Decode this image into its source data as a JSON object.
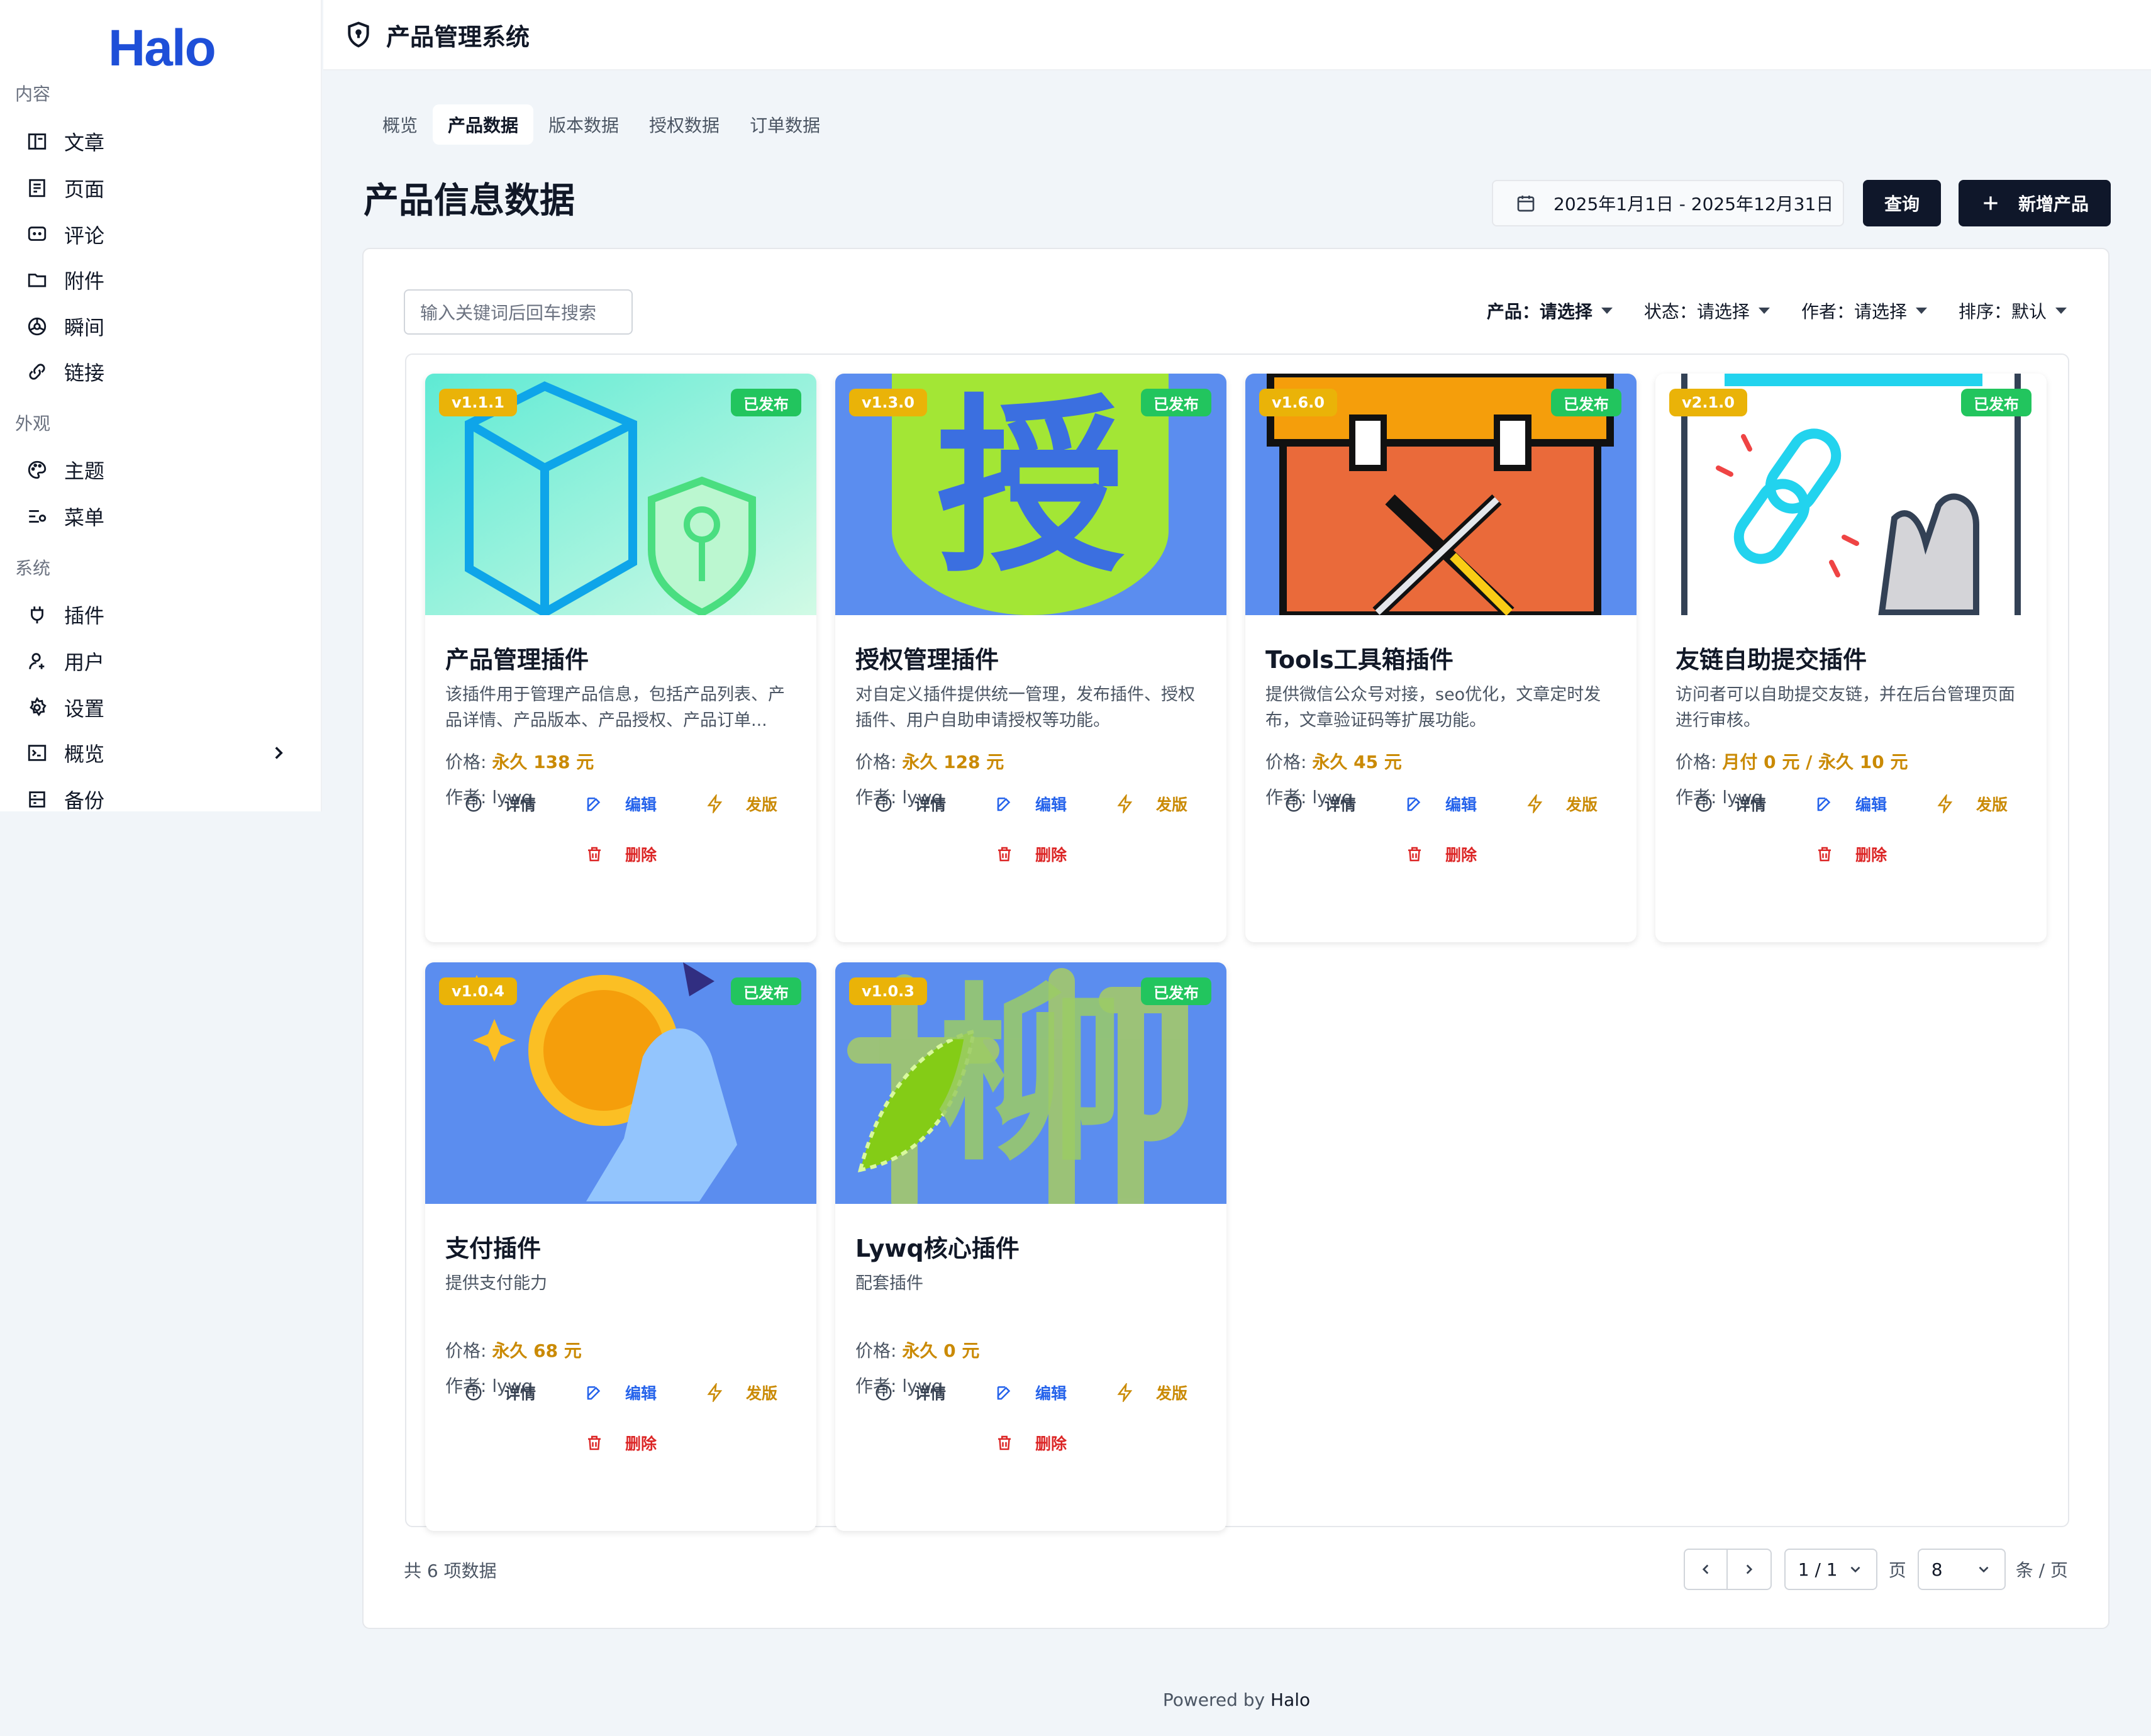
{
  "logo": "Halo",
  "sidebar": {
    "cut_label": "内容",
    "items_content": [
      {
        "label": "文章",
        "icon": "article-icon"
      },
      {
        "label": "页面",
        "icon": "page-icon"
      },
      {
        "label": "评论",
        "icon": "comment-icon"
      },
      {
        "label": "附件",
        "icon": "folder-icon"
      },
      {
        "label": "瞬间",
        "icon": "moment-icon"
      },
      {
        "label": "链接",
        "icon": "link-icon"
      }
    ],
    "group_appearance": "外观",
    "items_appearance": [
      {
        "label": "主题",
        "icon": "palette-icon"
      },
      {
        "label": "菜单",
        "icon": "menu-icon"
      }
    ],
    "group_system": "系统",
    "items_system": [
      {
        "label": "插件",
        "icon": "plugin-icon"
      },
      {
        "label": "用户",
        "icon": "user-icon"
      },
      {
        "label": "设置",
        "icon": "gear-icon"
      },
      {
        "label": "概览",
        "icon": "terminal-icon"
      },
      {
        "label": "备份",
        "icon": "backup-icon"
      }
    ]
  },
  "topbar": {
    "title": "产品管理系统"
  },
  "tabs": [
    "概览",
    "产品数据",
    "版本数据",
    "授权数据",
    "订单数据"
  ],
  "active_tab": "产品数据",
  "page_title": "产品信息数据",
  "date_range": "2025年1月1日 - 2025年12月31日",
  "query_label": "查询",
  "add_label": "新增产品",
  "search_placeholder": "输入关键词后回车搜索",
  "filters": [
    {
      "label": "产品：",
      "value": "请选择"
    },
    {
      "label": "状态：",
      "value": "请选择"
    },
    {
      "label": "作者：",
      "value": "请选择"
    },
    {
      "label": "排序：",
      "value": "默认"
    }
  ],
  "actions": {
    "detail": "详情",
    "edit": "编辑",
    "release": "发版",
    "delete": "删除"
  },
  "price_label": "价格: ",
  "author_label": "作者: ",
  "products": [
    {
      "version": "v1.1.1",
      "status": "已发布",
      "title": "产品管理插件",
      "desc": "该插件用于管理产品信息，包括产品列表、产品详情、产品版本、产品授权、产品订单...",
      "price": "永久 138 元",
      "author": "lywq"
    },
    {
      "version": "v1.3.0",
      "status": "已发布",
      "title": "授权管理插件",
      "desc": "对自定义插件提供统一管理，发布插件、授权插件、用户自助申请授权等功能。",
      "price": "永久 128 元",
      "author": "lywq",
      "cover_char": "授"
    },
    {
      "version": "v1.6.0",
      "status": "已发布",
      "title": "Tools工具箱插件",
      "desc": "提供微信公众号对接，seo优化，文章定时发布，文章验证码等扩展功能。",
      "price": "永久 45 元",
      "author": "lywq"
    },
    {
      "version": "v2.1.0",
      "status": "已发布",
      "title": "友链自助提交插件",
      "desc": "访问者可以自助提交友链，并在后台管理页面进行审核。",
      "price": "月付 0 元 / 永久 10 元",
      "author": "lywq"
    },
    {
      "version": "v1.0.4",
      "status": "已发布",
      "title": "支付插件",
      "desc": "提供支付能力",
      "price": "永久 68 元",
      "author": "lywq"
    },
    {
      "version": "v1.0.3",
      "status": "已发布",
      "title": "Lywq核心插件",
      "desc": "配套插件",
      "price": "永久 0 元",
      "author": "lywq",
      "cover_char": "柳"
    }
  ],
  "total": "共 6 项数据",
  "pager": {
    "page": "1 / 1",
    "page_unit": "页",
    "size": "8",
    "size_unit": "条 / 页"
  },
  "footer_prefix": "Powered by ",
  "footer_brand": "Halo"
}
